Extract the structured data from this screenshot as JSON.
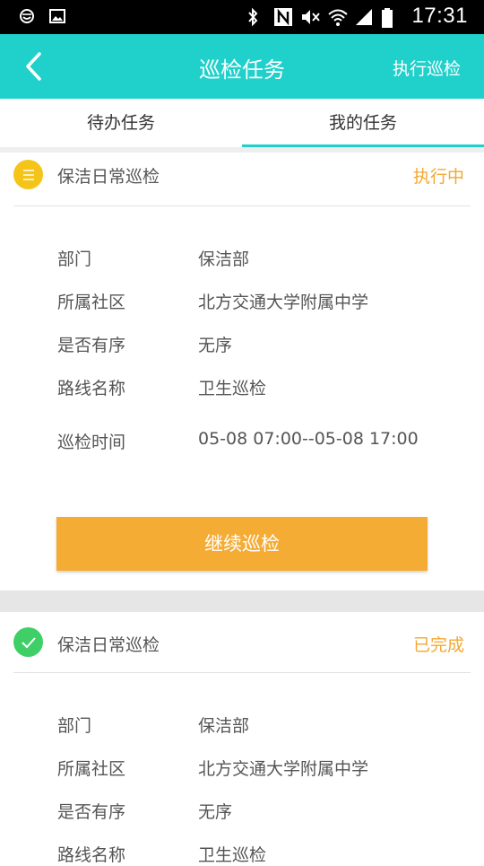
{
  "status_bar": {
    "time": "17:31",
    "left_icons": [
      "smiley-notification-icon",
      "image-notification-icon"
    ],
    "right_icons": [
      "bluetooth-icon",
      "nfc-icon",
      "mute-icon",
      "wifi-icon",
      "signal-icon",
      "battery-icon"
    ]
  },
  "header": {
    "title": "巡检任务",
    "action_label": "执行巡检",
    "background": "#20d0cb"
  },
  "tabs": [
    {
      "label": "待办任务",
      "selected": false
    },
    {
      "label": "我的任务",
      "selected": true
    }
  ],
  "tasks": [
    {
      "title": "保洁日常巡检",
      "status": "执行中",
      "status_icon": "list-icon",
      "fields": [
        {
          "label": "部门",
          "value": "保洁部"
        },
        {
          "label": "所属社区",
          "value": "北方交通大学附属中学"
        },
        {
          "label": "是否有序",
          "value": "无序"
        },
        {
          "label": "路线名称",
          "value": "卫生巡检"
        },
        {
          "label": "巡检时间",
          "value": "05-08 07:00--05-08 17:00"
        }
      ],
      "button_label": "继续巡检"
    },
    {
      "title": "保洁日常巡检",
      "status": "已完成",
      "status_icon": "check-icon",
      "fields": [
        {
          "label": "部门",
          "value": "保洁部"
        },
        {
          "label": "所属社区",
          "value": "北方交通大学附属中学"
        },
        {
          "label": "是否有序",
          "value": "无序"
        },
        {
          "label": "路线名称",
          "value": "卫生巡检"
        }
      ]
    }
  ],
  "colors": {
    "accent": "#20d0cb",
    "status_orange": "#f3a832",
    "button_orange": "#f5ac34",
    "in_progress_yellow": "#f5c419",
    "done_green": "#3fcf67"
  }
}
